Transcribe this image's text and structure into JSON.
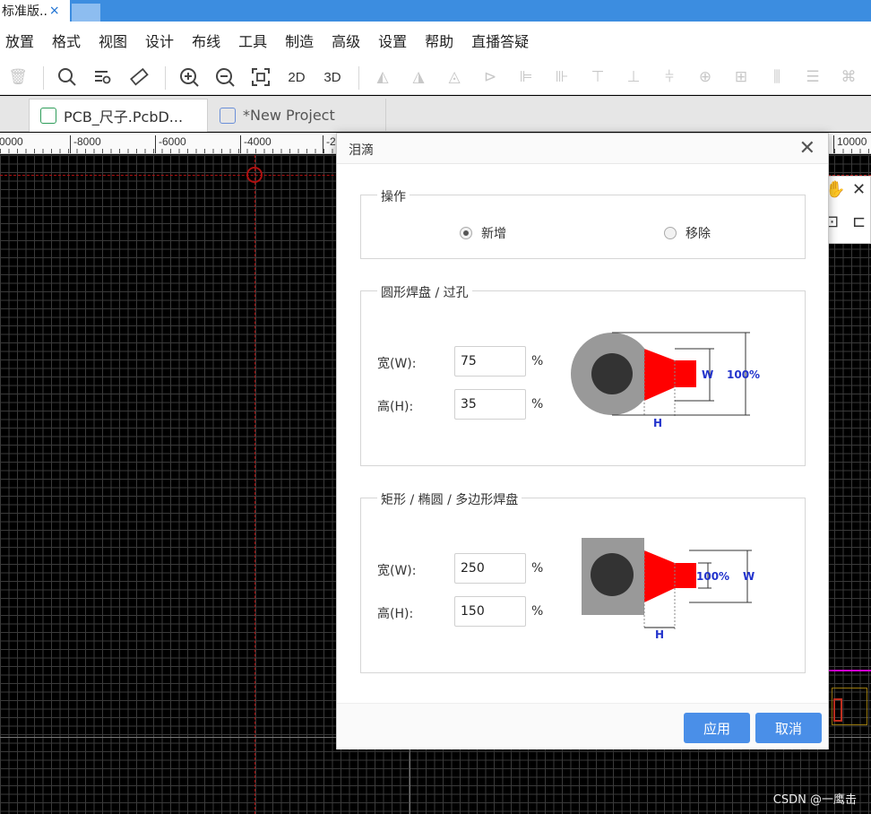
{
  "browser_tab": {
    "title": "标准版..",
    "close": "×"
  },
  "menu": [
    "放置",
    "格式",
    "视图",
    "设计",
    "布线",
    "工具",
    "制造",
    "高级",
    "设置",
    "帮助",
    "直播答疑"
  ],
  "toolbar": {
    "label_2d": "2D",
    "label_3d": "3D"
  },
  "doc_tabs": [
    {
      "label": "PCB_尺子.PcbD...",
      "icon": "pcb-doc-icon"
    },
    {
      "label": "*New Project",
      "icon": "project-icon"
    }
  ],
  "ruler": {
    "labels": [
      "0000",
      "-8000",
      "-6000",
      "-4000",
      "-2"
    ],
    "right_label": "10000"
  },
  "dialog": {
    "title": "泪滴",
    "close": "✕",
    "operation": {
      "title": "操作",
      "options": [
        {
          "label": "新增",
          "selected": true
        },
        {
          "label": "移除",
          "selected": false
        }
      ]
    },
    "round_pad": {
      "title": "圆形焊盘 / 过孔",
      "width_label": "宽(W):",
      "width_value": "75",
      "height_label": "高(H):",
      "height_value": "35",
      "unit": "%",
      "diagram": {
        "w": "W",
        "pct": "100%",
        "h": "H"
      }
    },
    "rect_pad": {
      "title": "矩形 / 椭圆 / 多边形焊盘",
      "width_label": "宽(W):",
      "width_value": "250",
      "height_label": "高(H):",
      "height_value": "150",
      "unit": "%",
      "diagram": {
        "pct": "100%",
        "w": "W",
        "h": "H"
      }
    },
    "buttons": {
      "apply": "应用",
      "cancel": "取消"
    }
  },
  "watermark": "CSDN @一鹰击",
  "colors": {
    "teardrop": "#ff0000",
    "pad": "#999999",
    "hole": "#333333",
    "dim_text": "#2233cc",
    "button": "#4a8fe8",
    "accent_tab": "#3c8de0"
  }
}
